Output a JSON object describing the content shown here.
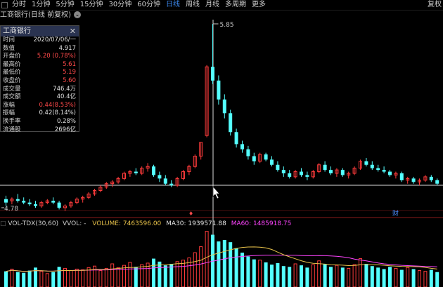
{
  "toolbar": {
    "items": [
      {
        "label": "分时",
        "active": false
      },
      {
        "label": "1分钟",
        "active": false
      },
      {
        "label": "5分钟",
        "active": false
      },
      {
        "label": "15分钟",
        "active": false
      },
      {
        "label": "30分钟",
        "active": false
      },
      {
        "label": "60分钟",
        "active": false
      },
      {
        "label": "日线",
        "active": true
      },
      {
        "label": "周线",
        "active": false
      },
      {
        "label": "月线",
        "active": false
      },
      {
        "label": "多周期",
        "active": false
      },
      {
        "label": "更多",
        "active": false
      }
    ],
    "right_label": "复权"
  },
  "title": {
    "text": "工商银行(日线 前复权)"
  },
  "info_panel": {
    "header": "工商银行",
    "rows": [
      {
        "label": "时间",
        "value": "2020/07/06/一",
        "red": false
      },
      {
        "label": "数值",
        "value": "4.917",
        "red": false
      },
      {
        "label": "开盘价",
        "value": "5.20 (0.78%)",
        "red": true
      },
      {
        "label": "最高价",
        "value": "5.61",
        "red": true
      },
      {
        "label": "最低价",
        "value": "5.19",
        "red": true
      },
      {
        "label": "收盘价",
        "value": "5.60",
        "red": true
      },
      {
        "label": "成交量",
        "value": "746.4万",
        "red": false
      },
      {
        "label": "成交额",
        "value": "40.4亿",
        "red": false
      },
      {
        "label": "涨幅",
        "value": "0.44(8.53%)",
        "red": true
      },
      {
        "label": "振幅",
        "value": "0.42(8.14%)",
        "red": false
      },
      {
        "label": "换手率",
        "value": "0.28%",
        "red": false
      },
      {
        "label": "流通股",
        "value": "2696亿",
        "red": false
      }
    ]
  },
  "chart": {
    "high_label": "5.85",
    "low_label": "4.78",
    "marker_bottom_left": "♦",
    "marker_bottom_right": "财"
  },
  "volume": {
    "indicator": "VOL-TDX(30,60)",
    "vvol": "VVOL: -",
    "volume_text": "VOLUME: 7463596.00",
    "ma30_text": "MA30: 1939571.88",
    "ma60_text": "MA60: 1485918.75"
  },
  "colors": {
    "up": "#ff3b3b",
    "down": "#54ffff",
    "ma30": "#e6e6e6",
    "ma60": "#ff44ff",
    "vol_ma": "#e8c24a"
  },
  "chart_data": {
    "type": "candlestick",
    "candles": [
      {
        "o": 4.83,
        "h": 4.85,
        "l": 4.79,
        "c": 4.81
      },
      {
        "o": 4.82,
        "h": 4.84,
        "l": 4.8,
        "c": 4.83
      },
      {
        "o": 4.83,
        "h": 4.86,
        "l": 4.81,
        "c": 4.82
      },
      {
        "o": 4.82,
        "h": 4.84,
        "l": 4.8,
        "c": 4.81
      },
      {
        "o": 4.81,
        "h": 4.83,
        "l": 4.79,
        "c": 4.8
      },
      {
        "o": 4.8,
        "h": 4.82,
        "l": 4.78,
        "c": 4.79
      },
      {
        "o": 4.79,
        "h": 4.82,
        "l": 4.78,
        "c": 4.81
      },
      {
        "o": 4.81,
        "h": 4.83,
        "l": 4.8,
        "c": 4.82
      },
      {
        "o": 4.82,
        "h": 4.84,
        "l": 4.8,
        "c": 4.81
      },
      {
        "o": 4.81,
        "h": 4.82,
        "l": 4.77,
        "c": 4.78
      },
      {
        "o": 4.78,
        "h": 4.8,
        "l": 4.76,
        "c": 4.79
      },
      {
        "o": 4.79,
        "h": 4.82,
        "l": 4.78,
        "c": 4.81
      },
      {
        "o": 4.81,
        "h": 4.84,
        "l": 4.8,
        "c": 4.83
      },
      {
        "o": 4.83,
        "h": 4.85,
        "l": 4.81,
        "c": 4.84
      },
      {
        "o": 4.84,
        "h": 4.87,
        "l": 4.83,
        "c": 4.86
      },
      {
        "o": 4.86,
        "h": 4.89,
        "l": 4.85,
        "c": 4.88
      },
      {
        "o": 4.88,
        "h": 4.91,
        "l": 4.87,
        "c": 4.9
      },
      {
        "o": 4.9,
        "h": 4.93,
        "l": 4.89,
        "c": 4.92
      },
      {
        "o": 4.92,
        "h": 4.94,
        "l": 4.9,
        "c": 4.93
      },
      {
        "o": 4.93,
        "h": 4.96,
        "l": 4.92,
        "c": 4.95
      },
      {
        "o": 4.95,
        "h": 4.99,
        "l": 4.94,
        "c": 4.98
      },
      {
        "o": 4.98,
        "h": 5.0,
        "l": 4.96,
        "c": 4.99
      },
      {
        "o": 4.99,
        "h": 5.01,
        "l": 4.97,
        "c": 4.98
      },
      {
        "o": 4.98,
        "h": 5.02,
        "l": 4.97,
        "c": 5.01
      },
      {
        "o": 5.01,
        "h": 5.04,
        "l": 4.99,
        "c": 5.02
      },
      {
        "o": 5.02,
        "h": 5.03,
        "l": 4.96,
        "c": 4.97
      },
      {
        "o": 4.97,
        "h": 4.99,
        "l": 4.93,
        "c": 4.95
      },
      {
        "o": 4.95,
        "h": 4.97,
        "l": 4.91,
        "c": 4.92
      },
      {
        "o": 4.92,
        "h": 4.94,
        "l": 4.9,
        "c": 4.91
      },
      {
        "o": 4.91,
        "h": 4.96,
        "l": 4.9,
        "c": 4.95
      },
      {
        "o": 4.95,
        "h": 5.0,
        "l": 4.94,
        "c": 4.99
      },
      {
        "o": 4.99,
        "h": 5.03,
        "l": 4.97,
        "c": 5.02
      },
      {
        "o": 5.02,
        "h": 5.09,
        "l": 5.01,
        "c": 5.08
      },
      {
        "o": 5.08,
        "h": 5.16,
        "l": 5.06,
        "c": 5.16
      },
      {
        "o": 5.2,
        "h": 5.61,
        "l": 5.19,
        "c": 5.6
      },
      {
        "o": 5.6,
        "h": 5.85,
        "l": 5.5,
        "c": 5.52
      },
      {
        "o": 5.52,
        "h": 5.55,
        "l": 5.38,
        "c": 5.41
      },
      {
        "o": 5.41,
        "h": 5.44,
        "l": 5.3,
        "c": 5.33
      },
      {
        "o": 5.33,
        "h": 5.35,
        "l": 5.2,
        "c": 5.22
      },
      {
        "o": 5.22,
        "h": 5.24,
        "l": 5.13,
        "c": 5.15
      },
      {
        "o": 5.15,
        "h": 5.17,
        "l": 5.1,
        "c": 5.12
      },
      {
        "o": 5.12,
        "h": 5.14,
        "l": 5.06,
        "c": 5.08
      },
      {
        "o": 5.08,
        "h": 5.1,
        "l": 5.03,
        "c": 5.05
      },
      {
        "o": 5.05,
        "h": 5.1,
        "l": 5.04,
        "c": 5.09
      },
      {
        "o": 5.09,
        "h": 5.1,
        "l": 5.05,
        "c": 5.06
      },
      {
        "o": 5.06,
        "h": 5.08,
        "l": 5.02,
        "c": 5.03
      },
      {
        "o": 5.03,
        "h": 5.05,
        "l": 4.99,
        "c": 5.0
      },
      {
        "o": 5.0,
        "h": 5.02,
        "l": 4.96,
        "c": 4.98
      },
      {
        "o": 4.98,
        "h": 5.0,
        "l": 4.95,
        "c": 4.96
      },
      {
        "o": 4.96,
        "h": 5.0,
        "l": 4.95,
        "c": 4.99
      },
      {
        "o": 4.99,
        "h": 5.01,
        "l": 4.96,
        "c": 4.97
      },
      {
        "o": 4.97,
        "h": 4.99,
        "l": 4.94,
        "c": 4.96
      },
      {
        "o": 4.96,
        "h": 5.0,
        "l": 4.95,
        "c": 4.99
      },
      {
        "o": 4.99,
        "h": 5.04,
        "l": 4.98,
        "c": 5.03
      },
      {
        "o": 5.03,
        "h": 5.05,
        "l": 4.99,
        "c": 5.0
      },
      {
        "o": 5.0,
        "h": 5.02,
        "l": 4.97,
        "c": 4.98
      },
      {
        "o": 4.98,
        "h": 5.01,
        "l": 4.96,
        "c": 5.0
      },
      {
        "o": 5.0,
        "h": 5.01,
        "l": 4.96,
        "c": 4.97
      },
      {
        "o": 4.97,
        "h": 4.99,
        "l": 4.95,
        "c": 4.98
      },
      {
        "o": 4.98,
        "h": 5.02,
        "l": 4.97,
        "c": 5.01
      },
      {
        "o": 5.01,
        "h": 5.06,
        "l": 5.0,
        "c": 5.05
      },
      {
        "o": 5.05,
        "h": 5.07,
        "l": 5.02,
        "c": 5.03
      },
      {
        "o": 5.03,
        "h": 5.05,
        "l": 5.0,
        "c": 5.01
      },
      {
        "o": 5.01,
        "h": 5.03,
        "l": 4.99,
        "c": 5.0
      },
      {
        "o": 5.0,
        "h": 5.02,
        "l": 4.98,
        "c": 4.99
      },
      {
        "o": 4.99,
        "h": 5.0,
        "l": 4.96,
        "c": 4.97
      },
      {
        "o": 4.97,
        "h": 4.99,
        "l": 4.95,
        "c": 4.98
      },
      {
        "o": 4.98,
        "h": 4.99,
        "l": 4.93,
        "c": 4.94
      },
      {
        "o": 4.94,
        "h": 4.96,
        "l": 4.92,
        "c": 4.95
      },
      {
        "o": 4.95,
        "h": 4.96,
        "l": 4.92,
        "c": 4.93
      },
      {
        "o": 4.93,
        "h": 4.95,
        "l": 4.91,
        "c": 4.94
      },
      {
        "o": 4.94,
        "h": 4.97,
        "l": 4.93,
        "c": 4.96
      },
      {
        "o": 4.96,
        "h": 4.97,
        "l": 4.93,
        "c": 4.94
      },
      {
        "o": 4.94,
        "h": 4.95,
        "l": 4.91,
        "c": 4.92
      }
    ],
    "volumes": [
      2.1,
      2.4,
      2.0,
      1.9,
      2.2,
      2.6,
      2.1,
      1.8,
      2.0,
      2.7,
      2.5,
      2.2,
      2.4,
      2.3,
      2.6,
      2.8,
      2.2,
      2.5,
      3.1,
      2.6,
      2.9,
      3.3,
      2.7,
      3.0,
      3.2,
      3.8,
      3.4,
      2.9,
      3.1,
      3.4,
      3.6,
      3.9,
      4.6,
      5.4,
      7.46,
      7.0,
      6.1,
      6.3,
      6.0,
      5.2,
      4.6,
      4.1,
      3.7,
      3.6,
      3.3,
      3.0,
      3.2,
      2.8,
      2.7,
      3.1,
      2.9,
      2.6,
      3.0,
      3.5,
      3.1,
      2.7,
      2.9,
      2.6,
      2.5,
      3.0,
      3.8,
      3.1,
      2.8,
      2.6,
      2.4,
      2.7,
      2.5,
      2.3,
      2.6,
      2.4,
      2.2,
      2.1,
      2.3,
      2.0
    ]
  }
}
